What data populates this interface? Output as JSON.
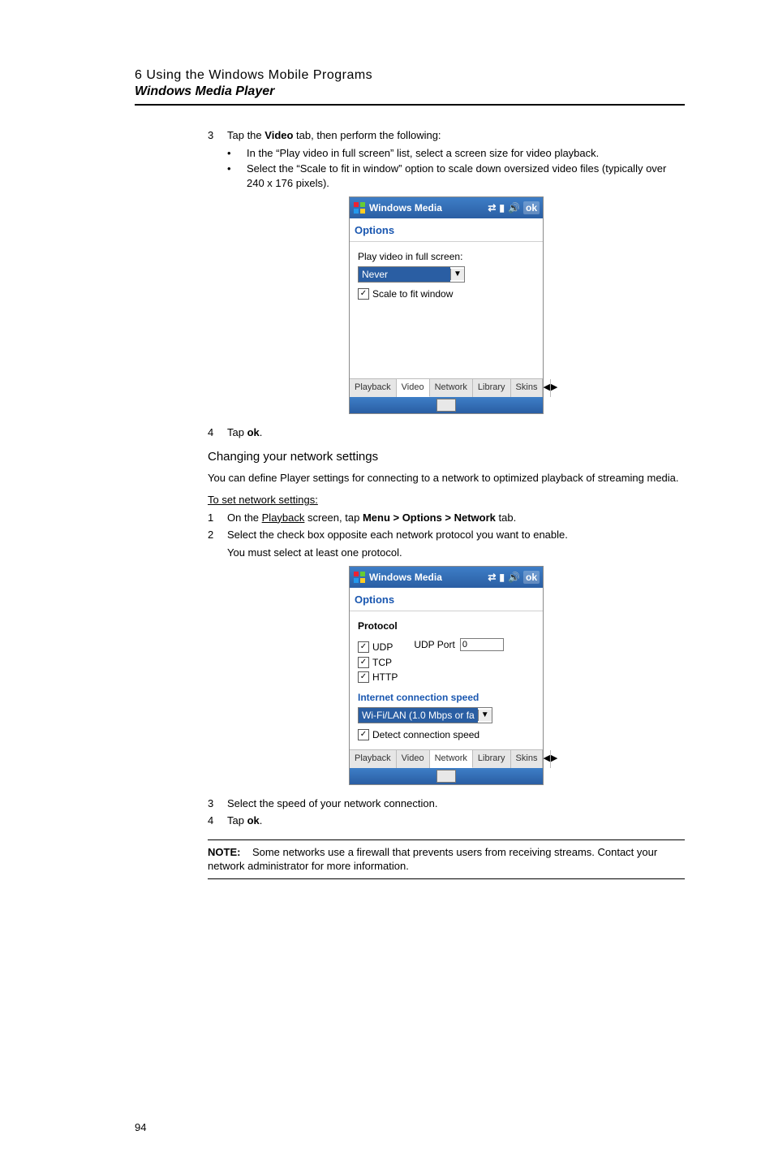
{
  "chapter": "6 Using the Windows Mobile Programs",
  "section": "Windows Media Player",
  "steps1": {
    "s3": {
      "num": "3",
      "text_a": "Tap the ",
      "bold": "Video",
      "text_b": " tab, then perform the following:"
    },
    "s3b1": "In the “Play video in full screen” list, select a screen size for video playback.",
    "s3b2": "Select the “Scale to fit in window” option to scale down oversized video files (typically over 240 x 176 pixels).",
    "s4": {
      "num": "4",
      "text_a": "Tap ",
      "bold": "ok",
      "text_b": "."
    }
  },
  "subhead1": "Changing your network settings",
  "para1": "You can define Player settings for connecting to a network to optimized playback of streaming media.",
  "toset": "To set network settings:",
  "steps2": {
    "s1": {
      "num": "1",
      "text_a": "On the ",
      "under": "Playback",
      "text_b": " screen, tap ",
      "bold": "Menu > Options > Network",
      "text_c": " tab."
    },
    "s2": {
      "num": "2",
      "text": "Select the check box opposite each network protocol you want to enable."
    },
    "s2_note": "You must select at least one protocol.",
    "s3": {
      "num": "3",
      "text": "Select the speed of your network connection."
    },
    "s4": {
      "num": "4",
      "text_a": "Tap ",
      "bold": "ok",
      "text_b": "."
    }
  },
  "note_label": "NOTE:",
  "note_text": "Some networks use a firewall that prevents users from receiving streams. Contact your network administrator for more information.",
  "page_number": "94",
  "phone_common": {
    "title": "Windows Media",
    "options": "Options",
    "ok_label": "ok",
    "tabs": {
      "playback": "Playback",
      "video": "Video",
      "network": "Network",
      "library": "Library",
      "skins": "Skins"
    }
  },
  "phone1": {
    "play_label": "Play video in full screen:",
    "select_val": "Never",
    "scale_label": "Scale to fit window"
  },
  "phone2": {
    "protocol": "Protocol",
    "udp": "UDP",
    "tcp": "TCP",
    "http": "HTTP",
    "udp_port_label": "UDP Port",
    "udp_port_val": "0",
    "ics_label": "Internet connection speed",
    "ics_sel": "Wi-Fi/LAN (1.0 Mbps or fa",
    "detect": "Detect connection speed"
  }
}
